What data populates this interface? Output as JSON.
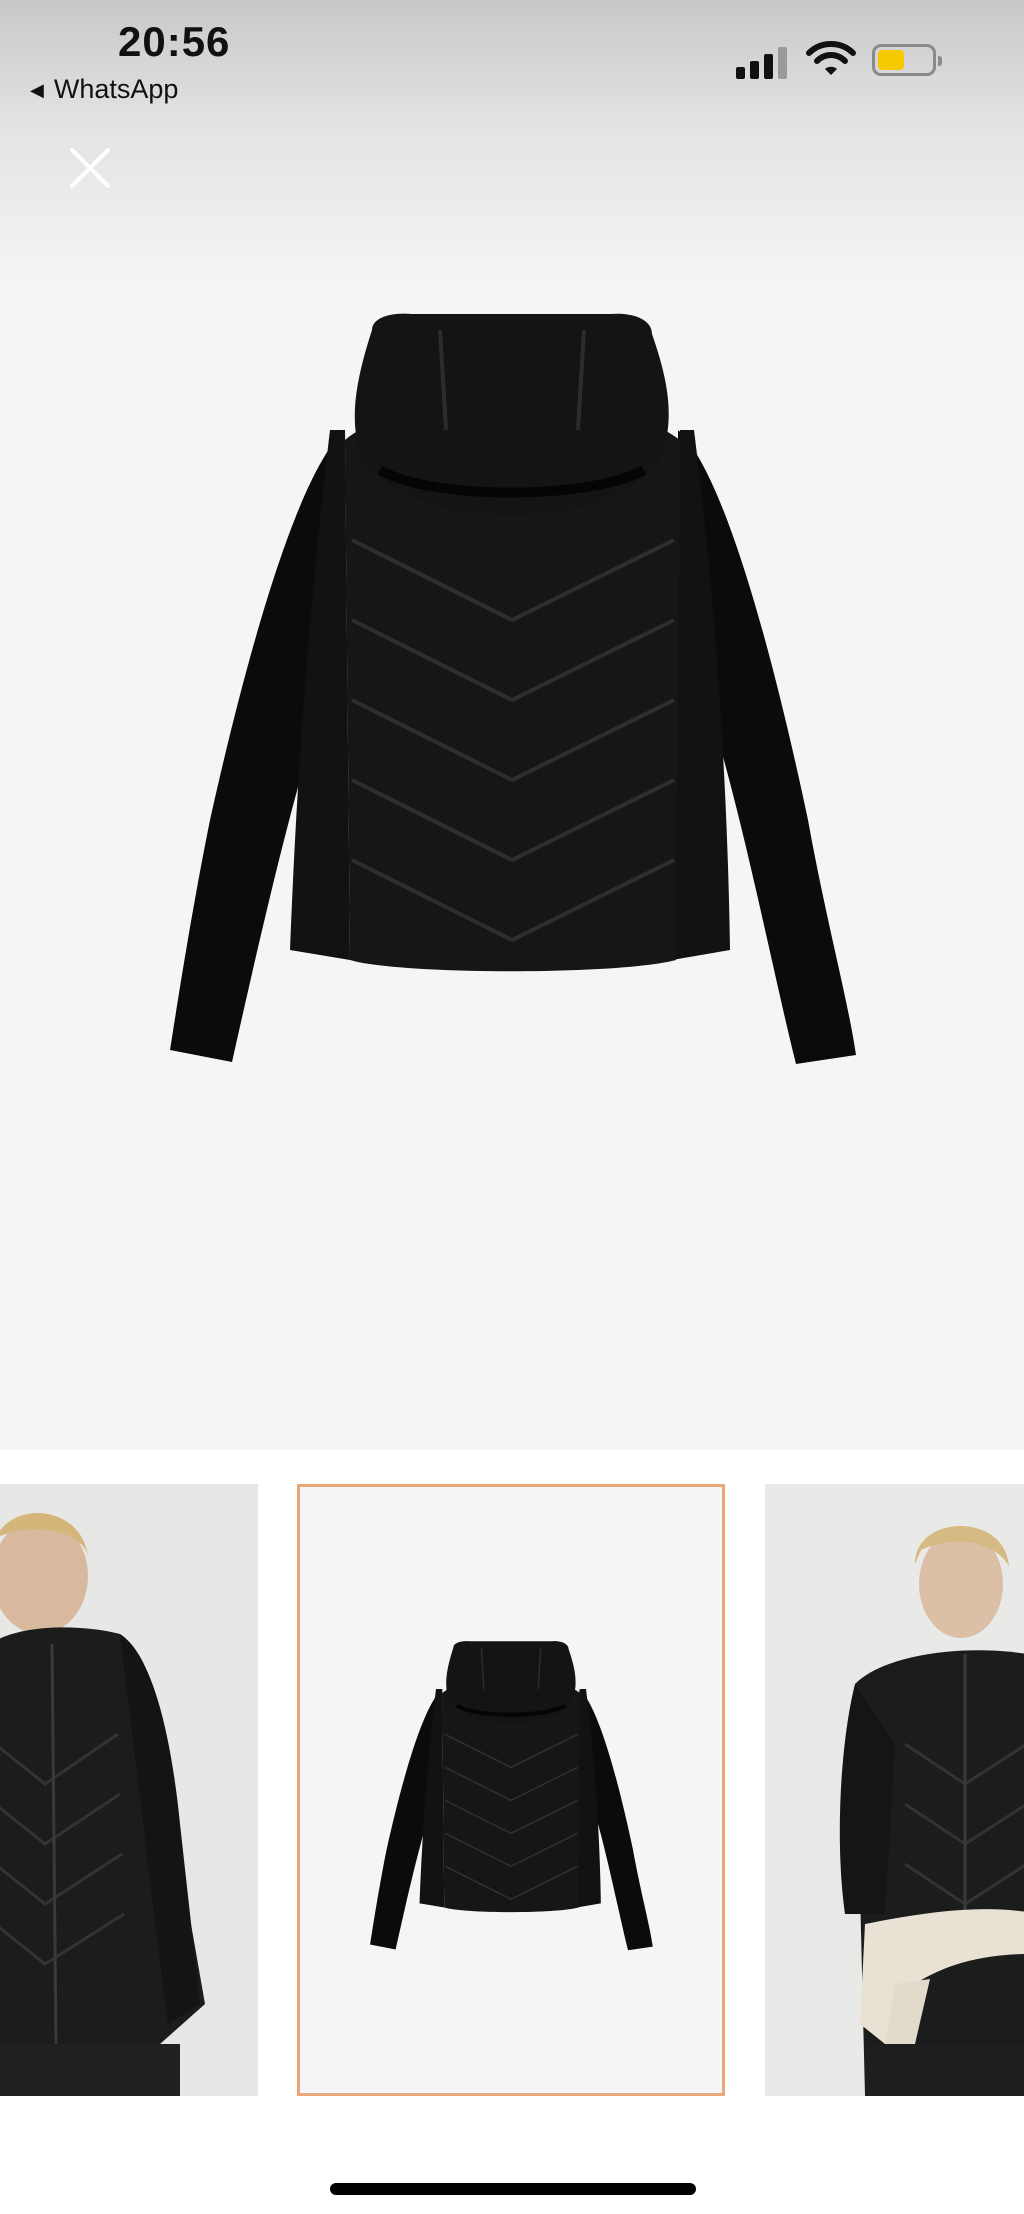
{
  "status_bar": {
    "time": "20:56",
    "back_app": "WhatsApp",
    "battery_color": "#f6c800"
  },
  "viewer": {
    "close_icon": "close-icon",
    "image": "black-hooded-jacket-back-view"
  },
  "thumbnails": [
    {
      "image": "model-wearing-jacket-front",
      "selected": false
    },
    {
      "image": "jacket-back-view",
      "selected": true
    },
    {
      "image": "model-wearing-jacket-with-sweater",
      "selected": false
    }
  ],
  "colors": {
    "selected_border": "#e8a77b",
    "background": "#f5f5f7"
  }
}
